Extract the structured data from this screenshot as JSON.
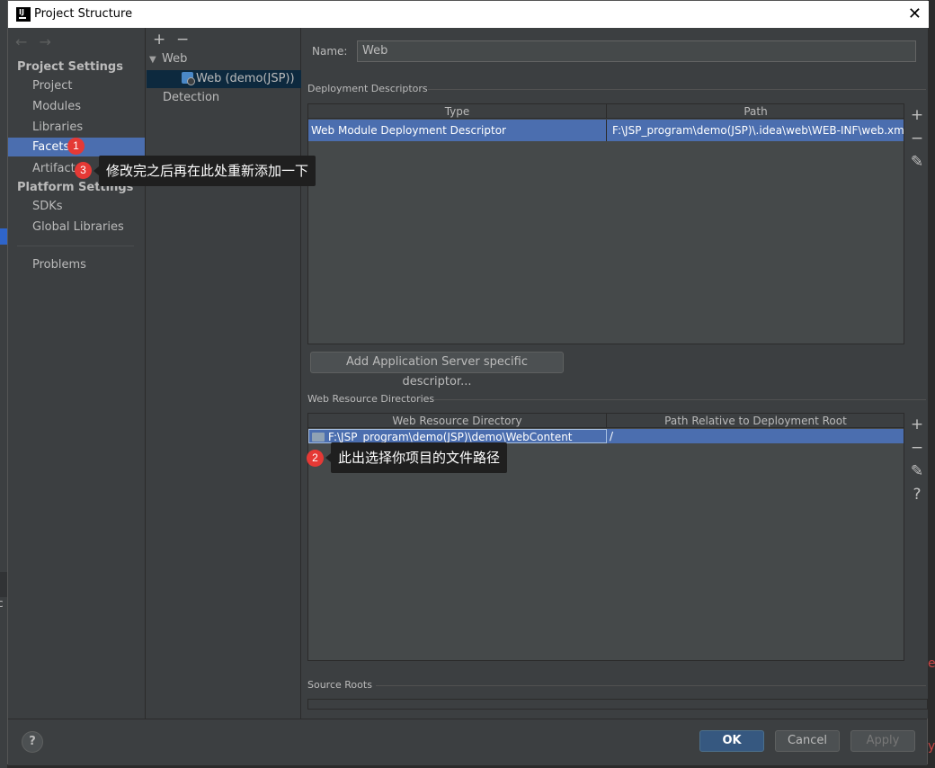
{
  "window": {
    "title": "Project Structure",
    "close_glyph": "✕"
  },
  "nav": {
    "back_glyph": "←",
    "forward_glyph": "→",
    "project_settings_header": "Project Settings",
    "project_settings_items": [
      "Project",
      "Modules",
      "Libraries",
      "Facets",
      "Artifacts"
    ],
    "platform_settings_header": "Platform Settings",
    "platform_settings_items": [
      "SDKs",
      "Global Libraries"
    ],
    "problems": "Problems",
    "selected": "Facets"
  },
  "tree": {
    "add_glyph": "+",
    "remove_glyph": "−",
    "group": "Web",
    "child": "Web (demo(JSP))",
    "detection": "Detection"
  },
  "content": {
    "name_label": "Name:",
    "name_value": "Web",
    "deployment": {
      "title": "Deployment Descriptors",
      "columns": [
        "Type",
        "Path"
      ],
      "rows": [
        {
          "type": "Web Module Deployment Descriptor",
          "path": "F:\\JSP_program\\demo(JSP)\\.idea\\web\\WEB-INF\\web.xml"
        }
      ],
      "add_server_button": "Add Application Server specific descriptor..."
    },
    "resources": {
      "title": "Web Resource Directories",
      "columns": [
        "Web Resource Directory",
        "Path Relative to Deployment Root"
      ],
      "rows": [
        {
          "directory": "F:\\JSP_program\\demo(JSP)\\demo\\WebContent",
          "relative": "/"
        }
      ]
    },
    "source_roots_title": "Source Roots",
    "tools": {
      "add": "+",
      "remove": "−",
      "edit": "✎",
      "help": "?"
    }
  },
  "buttons": {
    "ok": "OK",
    "cancel": "Cancel",
    "apply": "Apply",
    "help": "?"
  },
  "annotations": [
    {
      "number": "1"
    },
    {
      "number": "2",
      "text": "此出选择你项目的文件路径"
    },
    {
      "number": "3",
      "text": "修改完之后再在此处重新添加一下"
    }
  ],
  "background": {
    "left_char": "c"
  },
  "colors": {
    "selection": "#4b6eaf",
    "badge": "#e53935",
    "primary_button": "#365880"
  }
}
